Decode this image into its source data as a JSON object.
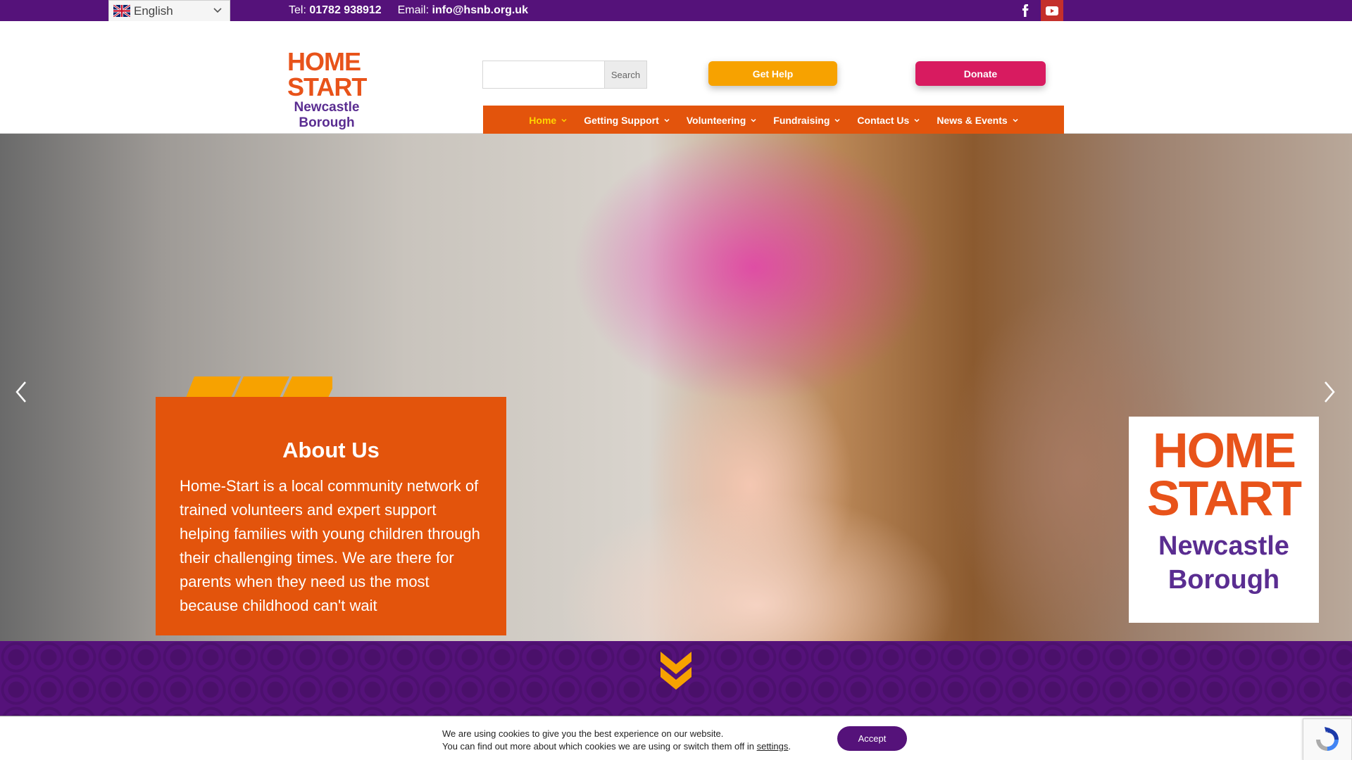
{
  "topbar": {
    "language": "English",
    "tel_label": "Tel:",
    "tel_number": "01782 938912",
    "email_label": "Email:",
    "email_address": "info@hsnb.org.uk",
    "social": [
      "facebook-icon",
      "youtube-icon"
    ],
    "youtube_color": "#c4302b"
  },
  "header": {
    "logo_line1": "HOME",
    "logo_line2": "START",
    "logo_line3": "Newcastle",
    "logo_line4": "Borough",
    "search": {
      "value": "",
      "placeholder": "",
      "button_label": "Search"
    },
    "get_help_label": "Get Help",
    "donate_label": "Donate"
  },
  "nav": {
    "items": [
      {
        "label": "Home",
        "active": true
      },
      {
        "label": "Getting Support",
        "active": false
      },
      {
        "label": "Volunteering",
        "active": false
      },
      {
        "label": "Fundraising",
        "active": false
      },
      {
        "label": "Contact Us",
        "active": false
      },
      {
        "label": "News & Events",
        "active": false
      }
    ]
  },
  "hero": {
    "title": "About Us",
    "body": "Home-Start is a local community network of trained volunteers and expert support helping families with young children through their challenging times. We are there for parents when they need us the most because childhood can't wait",
    "logo_line1": "HOME",
    "logo_line2": "START",
    "logo_line3": "Newcastle",
    "logo_line4": "Borough"
  },
  "cookie": {
    "line1": "We are using cookies to give you the best experience on our website.",
    "line2_prefix": "You can find out more about which cookies we are using or switch them off in ",
    "line2_link": "settings",
    "line2_suffix": ".",
    "accept_label": "Accept"
  },
  "colors": {
    "purple": "#55127a",
    "orange": "#e3540c",
    "yellow": "#f7a200",
    "pink": "#d81b60",
    "active_nav": "#ffd500"
  }
}
